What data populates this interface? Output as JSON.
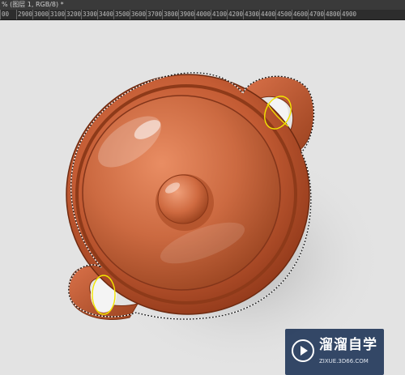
{
  "document_tab": {
    "title": "% (图层 1, RGB/8) *"
  },
  "ruler": {
    "labels": [
      "00",
      "2900",
      "3000",
      "3100",
      "3200",
      "3300",
      "3400",
      "3500",
      "3600",
      "3700",
      "3800",
      "3900",
      "4000",
      "4100",
      "4200",
      "4300",
      "4400",
      "4500",
      "4600",
      "4700",
      "4800",
      "4900"
    ]
  },
  "canvas": {
    "background_color": "#e3e3e3",
    "object": "terracotta-clay-pot-with-lid",
    "object_color": "#c9603a",
    "selection_marquee": "marching-ants",
    "annotation_color": "#f2e600"
  },
  "watermark": {
    "name": "溜溜自学",
    "url": "ZIXUE.3D66.COM",
    "logo_icon": "play-circle-icon",
    "background_color": "#0c254a"
  }
}
